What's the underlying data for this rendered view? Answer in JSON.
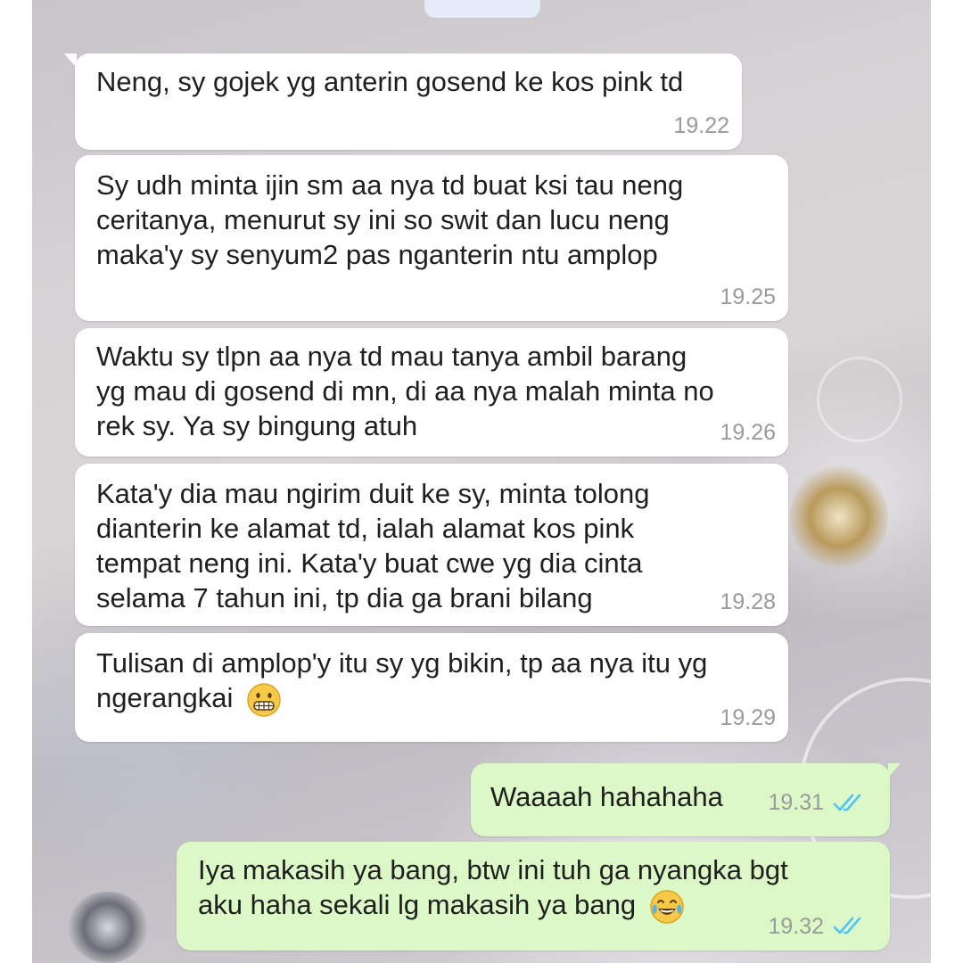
{
  "messages": [
    {
      "direction": "incoming",
      "lines": [
        "Neng, sy gojek yg anterin gosend ke kos pink td"
      ],
      "time": "19.22"
    },
    {
      "direction": "incoming",
      "lines": [
        "Sy udh minta ijin sm aa nya td buat ksi tau neng",
        "ceritanya, menurut sy ini so swit dan lucu neng",
        "maka'y sy senyum2 pas nganterin ntu amplop"
      ],
      "time": "19.25"
    },
    {
      "direction": "incoming",
      "lines": [
        "Waktu sy tlpn aa nya td mau tanya ambil barang",
        "yg mau di gosend di mn, di aa nya malah minta no",
        "rek sy. Ya sy bingung atuh"
      ],
      "time": "19.26"
    },
    {
      "direction": "incoming",
      "lines": [
        "Kata'y dia mau ngirim duit ke sy, minta tolong",
        "dianterin ke alamat td, ialah alamat kos pink",
        "tempat neng ini. Kata'y buat cwe yg dia cinta",
        "selama 7 tahun ini, tp dia ga brani bilang"
      ],
      "time": "19.28"
    },
    {
      "direction": "incoming",
      "lines": [
        "Tulisan di amplop'y itu sy yg bikin, tp aa nya itu yg",
        "ngerangkai"
      ],
      "emoji": "grimacing-face",
      "time": "19.29"
    },
    {
      "direction": "outgoing",
      "lines": [
        "Waaaah hahahaha"
      ],
      "time": "19.31",
      "status": "read"
    },
    {
      "direction": "outgoing",
      "lines": [
        "Iya makasih ya bang, btw ini tuh ga nyangka bgt",
        "aku haha sekali lg makasih ya bang"
      ],
      "emoji": "tears-of-joy-face",
      "time": "19.32",
      "status": "read"
    }
  ],
  "colors": {
    "incoming_bubble": "#ffffff",
    "outgoing_bubble": "#dcf8c6",
    "timestamp": "#9a9a9a",
    "read_ticks": "#4fc3f7"
  }
}
